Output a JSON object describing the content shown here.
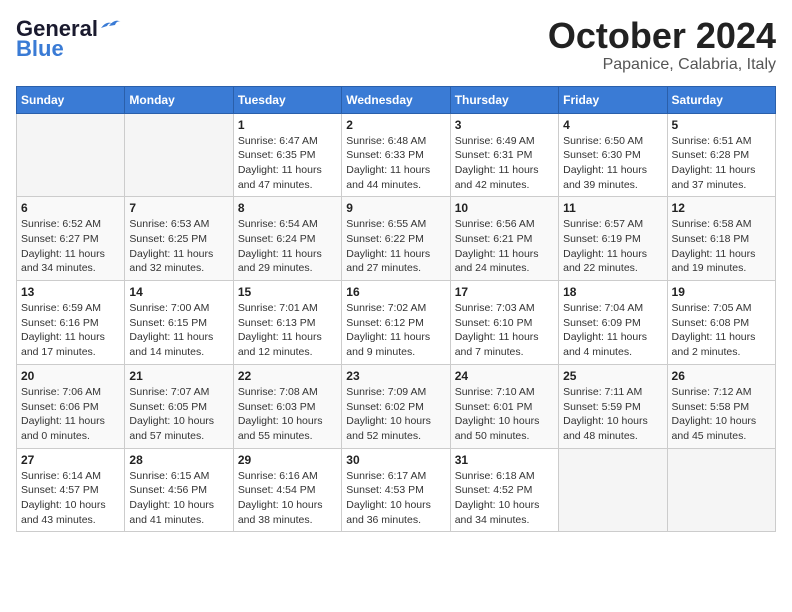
{
  "logo": {
    "general": "General",
    "blue": "Blue"
  },
  "header": {
    "month": "October 2024",
    "location": "Papanice, Calabria, Italy"
  },
  "weekdays": [
    "Sunday",
    "Monday",
    "Tuesday",
    "Wednesday",
    "Thursday",
    "Friday",
    "Saturday"
  ],
  "weeks": [
    [
      {
        "day": "",
        "sunrise": "",
        "sunset": "",
        "daylight": ""
      },
      {
        "day": "",
        "sunrise": "",
        "sunset": "",
        "daylight": ""
      },
      {
        "day": "1",
        "sunrise": "Sunrise: 6:47 AM",
        "sunset": "Sunset: 6:35 PM",
        "daylight": "Daylight: 11 hours and 47 minutes."
      },
      {
        "day": "2",
        "sunrise": "Sunrise: 6:48 AM",
        "sunset": "Sunset: 6:33 PM",
        "daylight": "Daylight: 11 hours and 44 minutes."
      },
      {
        "day": "3",
        "sunrise": "Sunrise: 6:49 AM",
        "sunset": "Sunset: 6:31 PM",
        "daylight": "Daylight: 11 hours and 42 minutes."
      },
      {
        "day": "4",
        "sunrise": "Sunrise: 6:50 AM",
        "sunset": "Sunset: 6:30 PM",
        "daylight": "Daylight: 11 hours and 39 minutes."
      },
      {
        "day": "5",
        "sunrise": "Sunrise: 6:51 AM",
        "sunset": "Sunset: 6:28 PM",
        "daylight": "Daylight: 11 hours and 37 minutes."
      }
    ],
    [
      {
        "day": "6",
        "sunrise": "Sunrise: 6:52 AM",
        "sunset": "Sunset: 6:27 PM",
        "daylight": "Daylight: 11 hours and 34 minutes."
      },
      {
        "day": "7",
        "sunrise": "Sunrise: 6:53 AM",
        "sunset": "Sunset: 6:25 PM",
        "daylight": "Daylight: 11 hours and 32 minutes."
      },
      {
        "day": "8",
        "sunrise": "Sunrise: 6:54 AM",
        "sunset": "Sunset: 6:24 PM",
        "daylight": "Daylight: 11 hours and 29 minutes."
      },
      {
        "day": "9",
        "sunrise": "Sunrise: 6:55 AM",
        "sunset": "Sunset: 6:22 PM",
        "daylight": "Daylight: 11 hours and 27 minutes."
      },
      {
        "day": "10",
        "sunrise": "Sunrise: 6:56 AM",
        "sunset": "Sunset: 6:21 PM",
        "daylight": "Daylight: 11 hours and 24 minutes."
      },
      {
        "day": "11",
        "sunrise": "Sunrise: 6:57 AM",
        "sunset": "Sunset: 6:19 PM",
        "daylight": "Daylight: 11 hours and 22 minutes."
      },
      {
        "day": "12",
        "sunrise": "Sunrise: 6:58 AM",
        "sunset": "Sunset: 6:18 PM",
        "daylight": "Daylight: 11 hours and 19 minutes."
      }
    ],
    [
      {
        "day": "13",
        "sunrise": "Sunrise: 6:59 AM",
        "sunset": "Sunset: 6:16 PM",
        "daylight": "Daylight: 11 hours and 17 minutes."
      },
      {
        "day": "14",
        "sunrise": "Sunrise: 7:00 AM",
        "sunset": "Sunset: 6:15 PM",
        "daylight": "Daylight: 11 hours and 14 minutes."
      },
      {
        "day": "15",
        "sunrise": "Sunrise: 7:01 AM",
        "sunset": "Sunset: 6:13 PM",
        "daylight": "Daylight: 11 hours and 12 minutes."
      },
      {
        "day": "16",
        "sunrise": "Sunrise: 7:02 AM",
        "sunset": "Sunset: 6:12 PM",
        "daylight": "Daylight: 11 hours and 9 minutes."
      },
      {
        "day": "17",
        "sunrise": "Sunrise: 7:03 AM",
        "sunset": "Sunset: 6:10 PM",
        "daylight": "Daylight: 11 hours and 7 minutes."
      },
      {
        "day": "18",
        "sunrise": "Sunrise: 7:04 AM",
        "sunset": "Sunset: 6:09 PM",
        "daylight": "Daylight: 11 hours and 4 minutes."
      },
      {
        "day": "19",
        "sunrise": "Sunrise: 7:05 AM",
        "sunset": "Sunset: 6:08 PM",
        "daylight": "Daylight: 11 hours and 2 minutes."
      }
    ],
    [
      {
        "day": "20",
        "sunrise": "Sunrise: 7:06 AM",
        "sunset": "Sunset: 6:06 PM",
        "daylight": "Daylight: 11 hours and 0 minutes."
      },
      {
        "day": "21",
        "sunrise": "Sunrise: 7:07 AM",
        "sunset": "Sunset: 6:05 PM",
        "daylight": "Daylight: 10 hours and 57 minutes."
      },
      {
        "day": "22",
        "sunrise": "Sunrise: 7:08 AM",
        "sunset": "Sunset: 6:03 PM",
        "daylight": "Daylight: 10 hours and 55 minutes."
      },
      {
        "day": "23",
        "sunrise": "Sunrise: 7:09 AM",
        "sunset": "Sunset: 6:02 PM",
        "daylight": "Daylight: 10 hours and 52 minutes."
      },
      {
        "day": "24",
        "sunrise": "Sunrise: 7:10 AM",
        "sunset": "Sunset: 6:01 PM",
        "daylight": "Daylight: 10 hours and 50 minutes."
      },
      {
        "day": "25",
        "sunrise": "Sunrise: 7:11 AM",
        "sunset": "Sunset: 5:59 PM",
        "daylight": "Daylight: 10 hours and 48 minutes."
      },
      {
        "day": "26",
        "sunrise": "Sunrise: 7:12 AM",
        "sunset": "Sunset: 5:58 PM",
        "daylight": "Daylight: 10 hours and 45 minutes."
      }
    ],
    [
      {
        "day": "27",
        "sunrise": "Sunrise: 6:14 AM",
        "sunset": "Sunset: 4:57 PM",
        "daylight": "Daylight: 10 hours and 43 minutes."
      },
      {
        "day": "28",
        "sunrise": "Sunrise: 6:15 AM",
        "sunset": "Sunset: 4:56 PM",
        "daylight": "Daylight: 10 hours and 41 minutes."
      },
      {
        "day": "29",
        "sunrise": "Sunrise: 6:16 AM",
        "sunset": "Sunset: 4:54 PM",
        "daylight": "Daylight: 10 hours and 38 minutes."
      },
      {
        "day": "30",
        "sunrise": "Sunrise: 6:17 AM",
        "sunset": "Sunset: 4:53 PM",
        "daylight": "Daylight: 10 hours and 36 minutes."
      },
      {
        "day": "31",
        "sunrise": "Sunrise: 6:18 AM",
        "sunset": "Sunset: 4:52 PM",
        "daylight": "Daylight: 10 hours and 34 minutes."
      },
      {
        "day": "",
        "sunrise": "",
        "sunset": "",
        "daylight": ""
      },
      {
        "day": "",
        "sunrise": "",
        "sunset": "",
        "daylight": ""
      }
    ]
  ]
}
